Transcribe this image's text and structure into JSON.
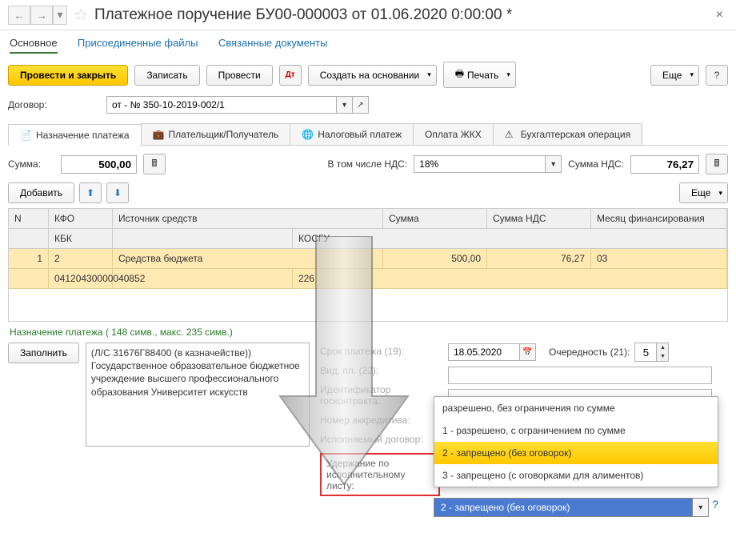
{
  "header": {
    "title": "Платежное поручение БУ00-000003 от 01.06.2020 0:00:00 *"
  },
  "nav": {
    "main": "Основное",
    "attached": "Присоединенные файлы",
    "related": "Связанные документы"
  },
  "toolbar": {
    "post_close": "Провести и закрыть",
    "save": "Записать",
    "post": "Провести",
    "create_based": "Создать на основании",
    "print": "Печать",
    "more": "Еще"
  },
  "contract": {
    "label": "Договор:",
    "value": "от - № 350-10-2019-002/1"
  },
  "tabs": {
    "purpose": "Назначение платежа",
    "payer": "Плательщик/Получатель",
    "tax": "Налоговый платеж",
    "zhkh": "Оплата ЖКХ",
    "acct": "Бухгалтерская операция"
  },
  "sums": {
    "sum_label": "Сумма:",
    "sum_val": "500,00",
    "incl_vat_label": "В том числе НДС:",
    "vat_rate": "18%",
    "vat_sum_label": "Сумма НДС:",
    "vat_sum_val": "76,27"
  },
  "table_toolbar": {
    "add": "Добавить",
    "more": "Еще"
  },
  "grid": {
    "headers": {
      "n": "N",
      "kfo": "КФО",
      "source": "Источник средств",
      "sum": "Сумма",
      "vat": "Сумма НДС",
      "month": "Месяц финансирования",
      "kbk": "КБК",
      "kosgu": "КОСГУ"
    },
    "rows": [
      {
        "n": "1",
        "kfo": "2",
        "source": "Средства бюджета",
        "sum": "500,00",
        "vat": "76,27",
        "month": "03",
        "kbk": "04120430000040852",
        "kosgu": "226"
      }
    ]
  },
  "naz": {
    "header": "Назначение платежа ( 148 симв., макс. 235 симв.)",
    "fill": "Заполнить",
    "text": "(Л/С 31676Г88400 (в казначействе)) Государственное образовательное бюджетное учреждение  высшего профессионального образования Университет искусств"
  },
  "midlabels": {
    "srok": "Срок платежа (19):",
    "vid": "Вид. пл. (22):",
    "ident": "Идентификатор госконтракта:",
    "akkred": "Номер аккредитива:",
    "ispoln": "Исполняемый договор:",
    "uderzh": "Удержание по исполнительному листу:"
  },
  "right": {
    "date": "18.05.2020",
    "order_label": "Очередность (21):",
    "order_val": "5"
  },
  "dropdown": {
    "options": [
      "разрешено, без ограничения по сумме",
      "1 - разрешено, с ограничением по сумме",
      "2 - запрещено (без оговорок)",
      "3 - запрещено (с оговорками для алиментов)"
    ],
    "selected": "2 - запрещено (без оговорок)"
  }
}
